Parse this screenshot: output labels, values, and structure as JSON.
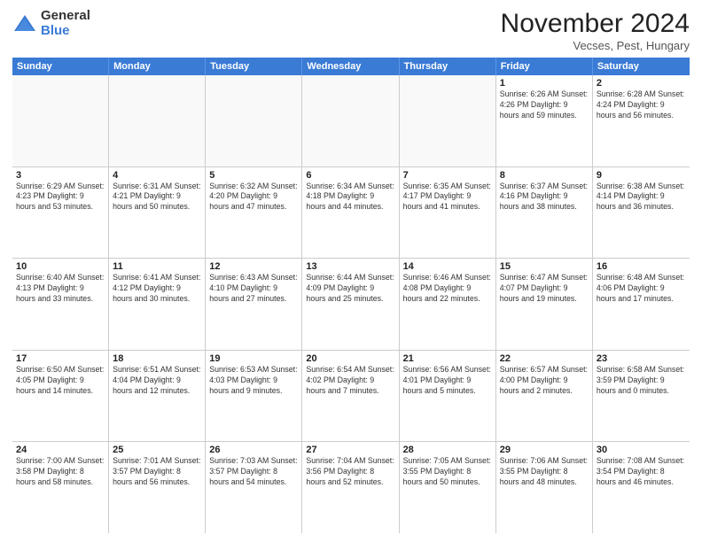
{
  "header": {
    "logo_general": "General",
    "logo_blue": "Blue",
    "title": "November 2024",
    "location": "Vecses, Pest, Hungary"
  },
  "days_of_week": [
    "Sunday",
    "Monday",
    "Tuesday",
    "Wednesday",
    "Thursday",
    "Friday",
    "Saturday"
  ],
  "weeks": [
    [
      {
        "day": "",
        "detail": ""
      },
      {
        "day": "",
        "detail": ""
      },
      {
        "day": "",
        "detail": ""
      },
      {
        "day": "",
        "detail": ""
      },
      {
        "day": "",
        "detail": ""
      },
      {
        "day": "1",
        "detail": "Sunrise: 6:26 AM\nSunset: 4:26 PM\nDaylight: 9 hours and 59 minutes."
      },
      {
        "day": "2",
        "detail": "Sunrise: 6:28 AM\nSunset: 4:24 PM\nDaylight: 9 hours and 56 minutes."
      }
    ],
    [
      {
        "day": "3",
        "detail": "Sunrise: 6:29 AM\nSunset: 4:23 PM\nDaylight: 9 hours and 53 minutes."
      },
      {
        "day": "4",
        "detail": "Sunrise: 6:31 AM\nSunset: 4:21 PM\nDaylight: 9 hours and 50 minutes."
      },
      {
        "day": "5",
        "detail": "Sunrise: 6:32 AM\nSunset: 4:20 PM\nDaylight: 9 hours and 47 minutes."
      },
      {
        "day": "6",
        "detail": "Sunrise: 6:34 AM\nSunset: 4:18 PM\nDaylight: 9 hours and 44 minutes."
      },
      {
        "day": "7",
        "detail": "Sunrise: 6:35 AM\nSunset: 4:17 PM\nDaylight: 9 hours and 41 minutes."
      },
      {
        "day": "8",
        "detail": "Sunrise: 6:37 AM\nSunset: 4:16 PM\nDaylight: 9 hours and 38 minutes."
      },
      {
        "day": "9",
        "detail": "Sunrise: 6:38 AM\nSunset: 4:14 PM\nDaylight: 9 hours and 36 minutes."
      }
    ],
    [
      {
        "day": "10",
        "detail": "Sunrise: 6:40 AM\nSunset: 4:13 PM\nDaylight: 9 hours and 33 minutes."
      },
      {
        "day": "11",
        "detail": "Sunrise: 6:41 AM\nSunset: 4:12 PM\nDaylight: 9 hours and 30 minutes."
      },
      {
        "day": "12",
        "detail": "Sunrise: 6:43 AM\nSunset: 4:10 PM\nDaylight: 9 hours and 27 minutes."
      },
      {
        "day": "13",
        "detail": "Sunrise: 6:44 AM\nSunset: 4:09 PM\nDaylight: 9 hours and 25 minutes."
      },
      {
        "day": "14",
        "detail": "Sunrise: 6:46 AM\nSunset: 4:08 PM\nDaylight: 9 hours and 22 minutes."
      },
      {
        "day": "15",
        "detail": "Sunrise: 6:47 AM\nSunset: 4:07 PM\nDaylight: 9 hours and 19 minutes."
      },
      {
        "day": "16",
        "detail": "Sunrise: 6:48 AM\nSunset: 4:06 PM\nDaylight: 9 hours and 17 minutes."
      }
    ],
    [
      {
        "day": "17",
        "detail": "Sunrise: 6:50 AM\nSunset: 4:05 PM\nDaylight: 9 hours and 14 minutes."
      },
      {
        "day": "18",
        "detail": "Sunrise: 6:51 AM\nSunset: 4:04 PM\nDaylight: 9 hours and 12 minutes."
      },
      {
        "day": "19",
        "detail": "Sunrise: 6:53 AM\nSunset: 4:03 PM\nDaylight: 9 hours and 9 minutes."
      },
      {
        "day": "20",
        "detail": "Sunrise: 6:54 AM\nSunset: 4:02 PM\nDaylight: 9 hours and 7 minutes."
      },
      {
        "day": "21",
        "detail": "Sunrise: 6:56 AM\nSunset: 4:01 PM\nDaylight: 9 hours and 5 minutes."
      },
      {
        "day": "22",
        "detail": "Sunrise: 6:57 AM\nSunset: 4:00 PM\nDaylight: 9 hours and 2 minutes."
      },
      {
        "day": "23",
        "detail": "Sunrise: 6:58 AM\nSunset: 3:59 PM\nDaylight: 9 hours and 0 minutes."
      }
    ],
    [
      {
        "day": "24",
        "detail": "Sunrise: 7:00 AM\nSunset: 3:58 PM\nDaylight: 8 hours and 58 minutes."
      },
      {
        "day": "25",
        "detail": "Sunrise: 7:01 AM\nSunset: 3:57 PM\nDaylight: 8 hours and 56 minutes."
      },
      {
        "day": "26",
        "detail": "Sunrise: 7:03 AM\nSunset: 3:57 PM\nDaylight: 8 hours and 54 minutes."
      },
      {
        "day": "27",
        "detail": "Sunrise: 7:04 AM\nSunset: 3:56 PM\nDaylight: 8 hours and 52 minutes."
      },
      {
        "day": "28",
        "detail": "Sunrise: 7:05 AM\nSunset: 3:55 PM\nDaylight: 8 hours and 50 minutes."
      },
      {
        "day": "29",
        "detail": "Sunrise: 7:06 AM\nSunset: 3:55 PM\nDaylight: 8 hours and 48 minutes."
      },
      {
        "day": "30",
        "detail": "Sunrise: 7:08 AM\nSunset: 3:54 PM\nDaylight: 8 hours and 46 minutes."
      }
    ]
  ]
}
